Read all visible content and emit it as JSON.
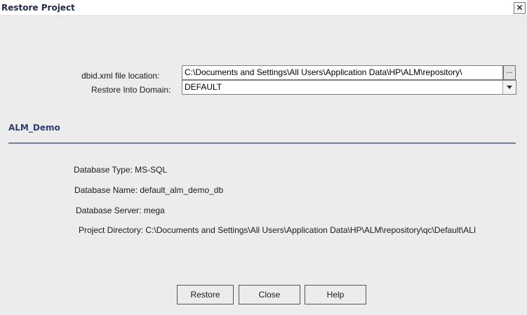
{
  "window": {
    "title": "Restore Project",
    "close_glyph": "✕"
  },
  "form": {
    "dbid_label": "dbid.xml file location:",
    "dbid_value": "C:\\Documents and Settings\\All Users\\Application Data\\HP\\ALM\\repository\\",
    "browse_label": "...",
    "domain_label": "Restore Into Domain:",
    "domain_value": "DEFAULT"
  },
  "project": {
    "name": "ALM_Demo",
    "db_type": "Database Type: MS-SQL",
    "db_name": "Database Name: default_alm_demo_db",
    "db_server": "Database Server: mega",
    "project_dir": "Project Directory: C:\\Documents and Settings\\All Users\\Application Data\\HP\\ALM\\repository\\qc\\Default\\ALI"
  },
  "buttons": {
    "restore": "Restore",
    "close": "Close",
    "help": "Help"
  }
}
